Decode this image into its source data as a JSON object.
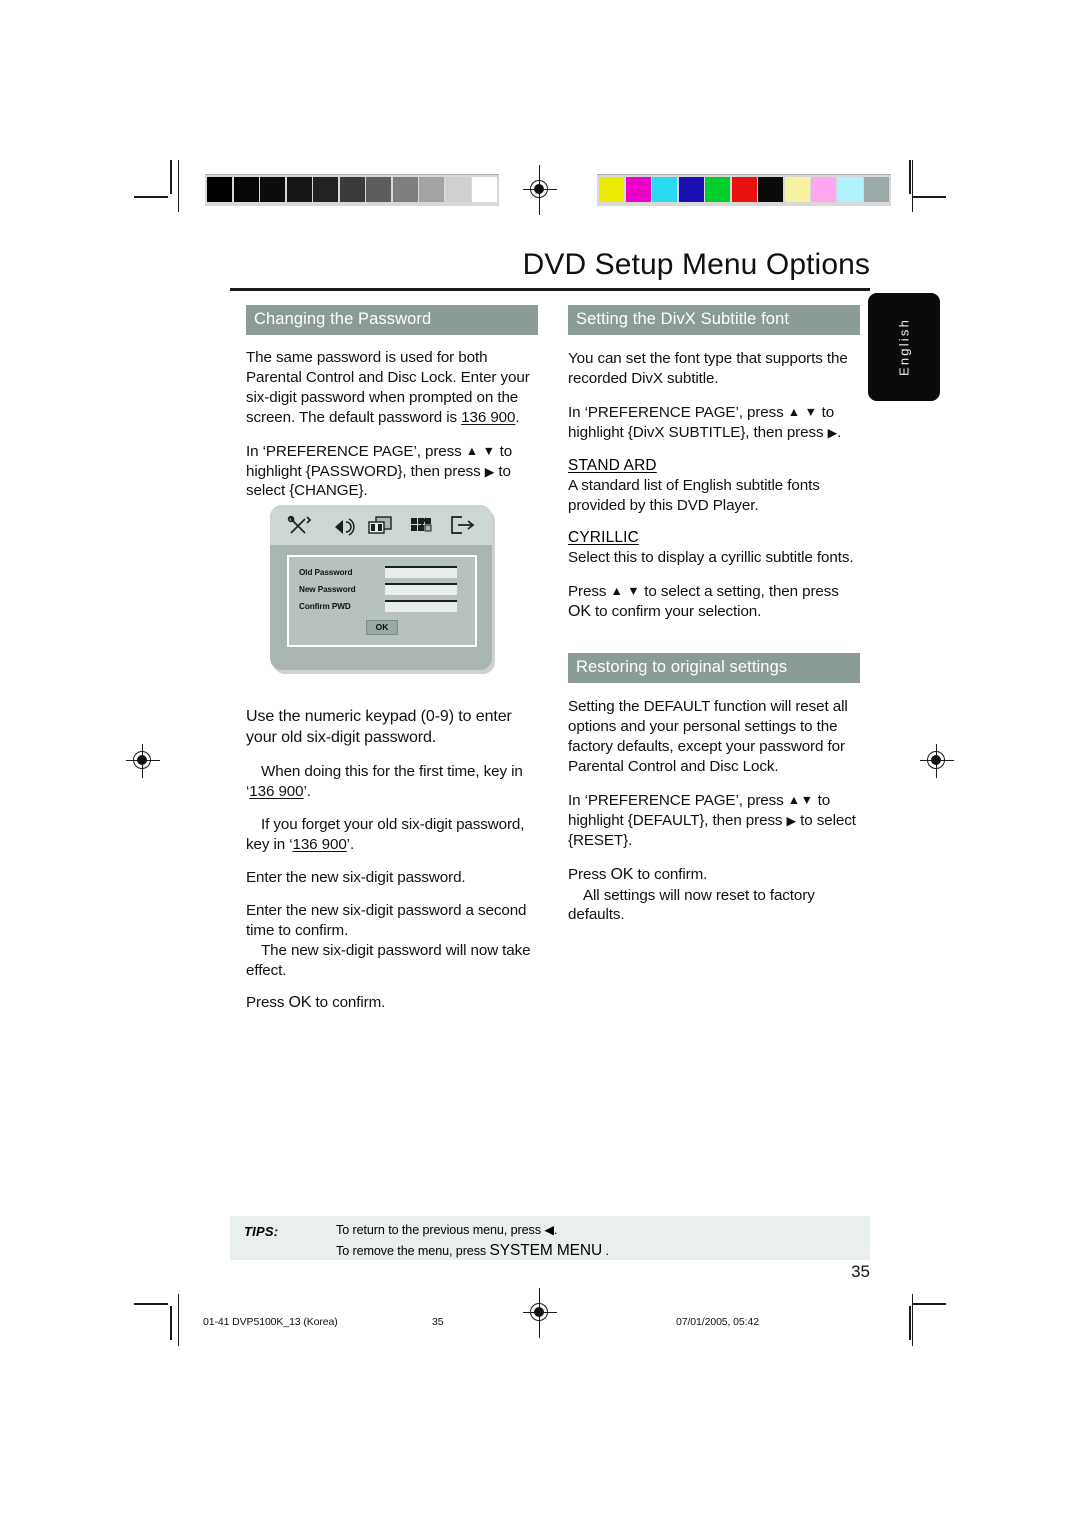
{
  "page": {
    "title": "DVD Setup Menu Options",
    "language_tab": "English",
    "page_number": "35"
  },
  "calibration": {
    "grayscale_label": "grayscale-bar",
    "grayscale_swatches": [
      "#000000",
      "#060606",
      "#0d0d0d",
      "#161616",
      "#222222",
      "#3b3b3b",
      "#5c5c5c",
      "#7e7e7e",
      "#a3a3a3",
      "#cfcfcf",
      "#ffffff"
    ],
    "color_label": "color-bar",
    "color_swatches": [
      "#ece900",
      "#ec00c8",
      "#2ad8f2",
      "#1a0fb5",
      "#00cf2a",
      "#ea1111",
      "#0b0b0b",
      "#f6f2a0",
      "#ffa6ee",
      "#b0f2ff",
      "#9aaaa8"
    ]
  },
  "left_column": {
    "heading": "Changing the Password",
    "p1_a": "The same password is used for both Parental Control and Disc Lock. Enter your six-digit password when prompted on the screen. The default password is ",
    "p1_code": "136 900",
    "p1_b": ".",
    "p2_a": "In ‘PREFERENCE PAGE’, press ",
    "p2_arrows": "▲ ▼",
    "p2_b": " to highlight {PASSWORD}, then press ",
    "p2_arrow_right": "▶",
    "p2_c": " to select {CHANGE}.",
    "p3": "Use the numeric keypad (0-9)  to enter your old six-digit password.",
    "p4_a": "When doing this for the first time, key in ‘",
    "p4_code": "136 900",
    "p4_b": "’.",
    "p5_a": "If you forget your old six-digit password, key in ‘",
    "p5_code": "136 900",
    "p5_b": "’.",
    "p6": "Enter the new six-digit password.",
    "p7": "Enter the new six-digit password a second time to confirm.",
    "p8": "The new six-digit password will now take effect.",
    "p9_a": "Press ",
    "p9_ok": "OK",
    "p9_b": " to confirm."
  },
  "osd_screenshot": {
    "name": "dvd-password-setup-screen",
    "toolbar_icons": [
      "tools-icon",
      "speaker-icon",
      "video-icon",
      "preference-grid-icon",
      "exit-icon"
    ],
    "fields": [
      {
        "label": "Old Password",
        "value": ""
      },
      {
        "label": "New Password",
        "value": ""
      },
      {
        "label": "Confirm PWD",
        "value": ""
      }
    ],
    "ok_button": "OK"
  },
  "right_column": {
    "heading_divx": "Setting the DivX Subtitle font",
    "d1": "You can set the font type that supports the recorded DivX subtitle.",
    "d2_a": "In ‘PREFERENCE PAGE’, press ",
    "d2_arrows": "▲ ▼",
    "d2_b": " to highlight {DivX SUBTITLE}, then press ",
    "d2_arrow_right": "▶",
    "d2_c": ".",
    "standard_head": "STAND ARD",
    "standard_body": "A standard list of English subtitle fonts provided by this DVD Player.",
    "cyrillic_head": "CYRILLIC ",
    "cyrillic_body": "Select this to display a cyrillic subtitle fonts.",
    "d3_a": "Press ",
    "d3_arrows": "▲ ▼",
    "d3_b": " to select a setting, then press ",
    "d3_ok": "OK",
    "d3_c": " to confirm your selection.",
    "heading_restore": "Restoring to original settings",
    "r1": "Setting the DEFAULT function will reset all options and your personal settings to the factory defaults, except your password for Parental Control and Disc Lock.",
    "r2_a": "In ‘PREFERENCE PAGE’, press ",
    "r2_arrows": "▲▼",
    "r2_b": " to highlight {DEFAULT}, then press ",
    "r2_arrow_right": "▶",
    "r2_c": " to select {RESET}.",
    "r3_a": "Press ",
    "r3_ok": "OK",
    "r3_b": " to confirm.",
    "r4": "All settings will now reset to factory defaults."
  },
  "tips": {
    "label": "TIPS:",
    "line1_a": "To return to the previous menu, press ",
    "line1_arrow": "◀",
    "line1_b": ".",
    "line2_a": "To remove the menu, press ",
    "line2_key": "SYSTEM MENU",
    "line2_b": " ."
  },
  "footer": {
    "file": "01-41 DVP5100K_13 (Korea)",
    "page": "35",
    "date": "07/01/2005, 05:42"
  },
  "colors": {
    "section_header_bg": "#8b9c98",
    "tips_bg": "#e9efee",
    "lang_tab_bg": "#0b0b0b",
    "osd_body": "#a8b5b2",
    "osd_toolbar": "#ccd6d3"
  }
}
